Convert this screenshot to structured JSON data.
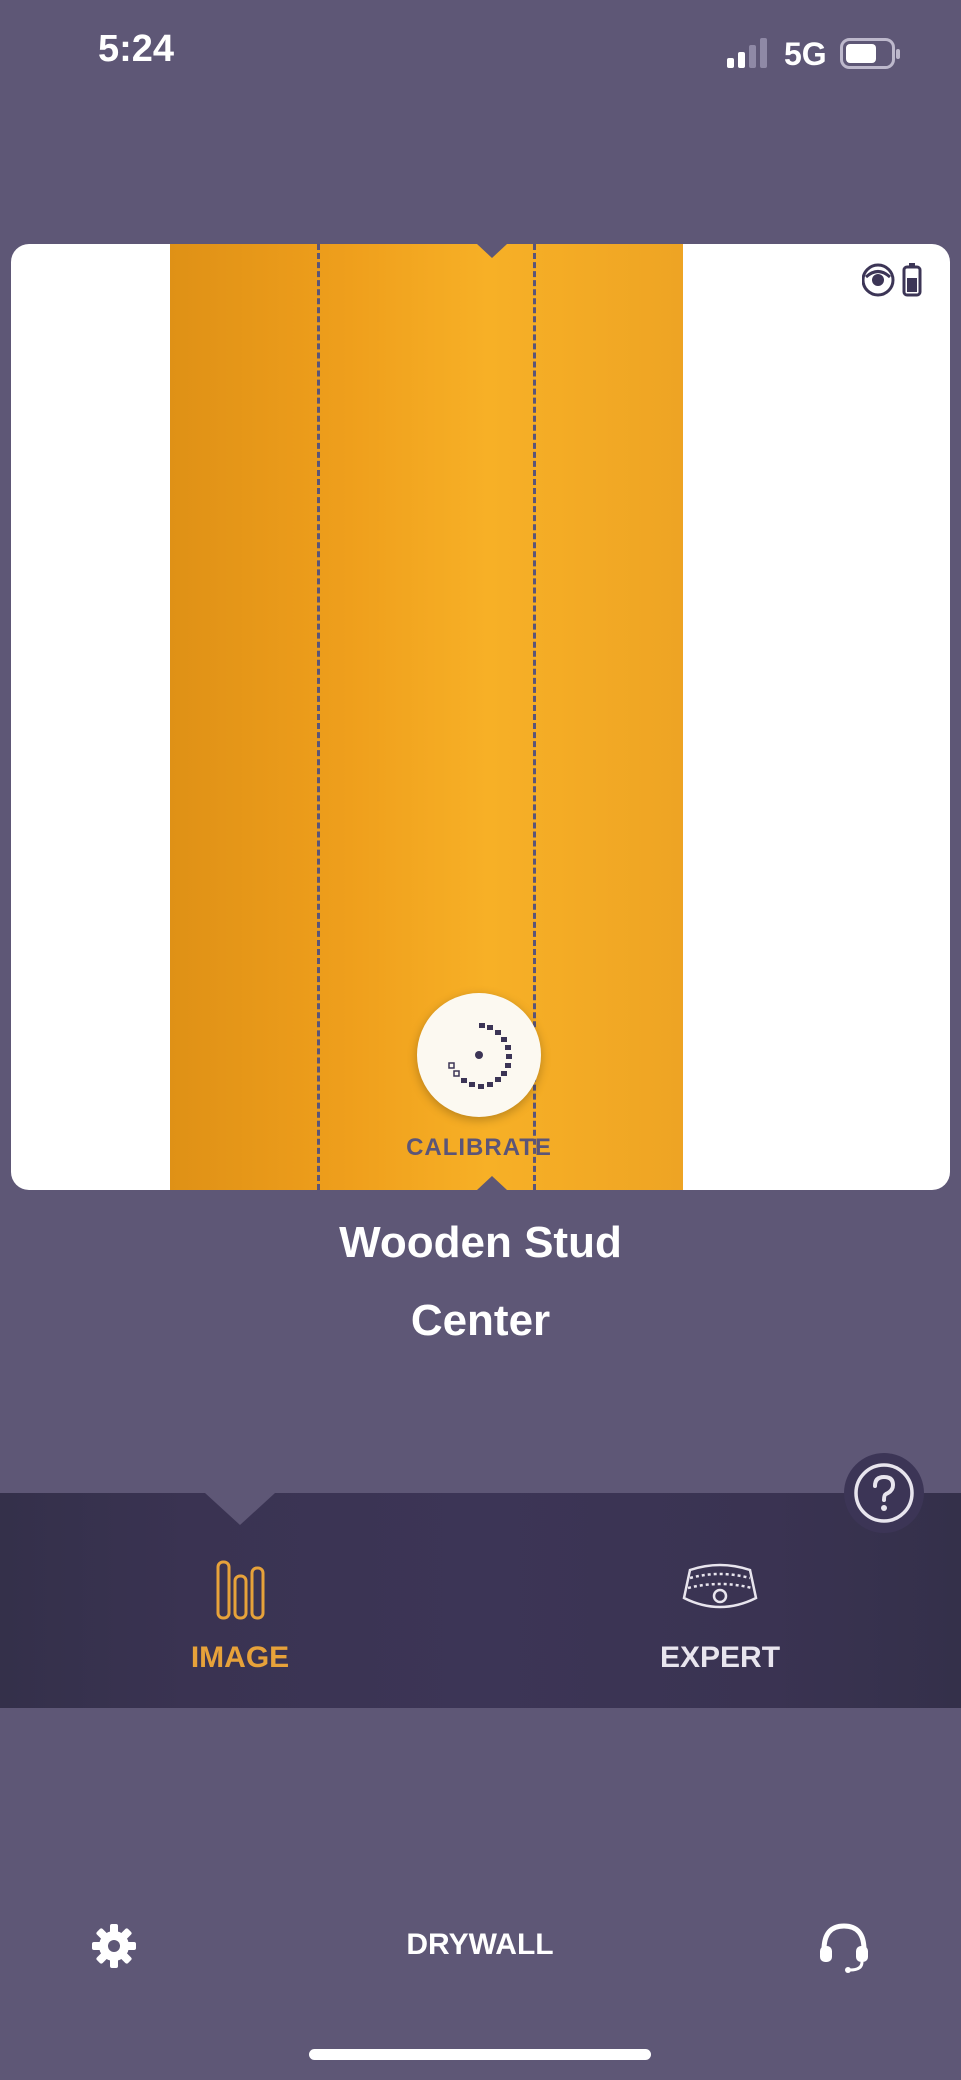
{
  "status_bar": {
    "time": "5:24",
    "network": "5G",
    "icons": [
      "cellular-signal-icon",
      "battery-icon"
    ]
  },
  "scanner": {
    "detected_object": "wooden-stud",
    "stud_color": "#f4a822",
    "card_background": "#ffffff",
    "status_icons": [
      "sensor-eye-icon",
      "device-battery-icon"
    ],
    "calibrate_label": "CALIBRATE",
    "calibrate_icon": "calibrate-dial-icon"
  },
  "result": {
    "material": "Wooden Stud",
    "position": "Center"
  },
  "modes": {
    "active": "IMAGE",
    "tabs": [
      {
        "label": "IMAGE",
        "icon": "stud-bars-icon",
        "active": true
      },
      {
        "label": "EXPERT",
        "icon": "radar-scan-icon",
        "active": false
      }
    ],
    "help_icon": "help-icon"
  },
  "bottom_bar": {
    "settings_icon": "gear-icon",
    "surface": "DRYWALL",
    "support_icon": "headset-support-icon"
  },
  "colors": {
    "background": "#5e5776",
    "accent": "#e7a23a",
    "mode_bar": "#3a3352",
    "dash_lines": "#5b5578"
  }
}
